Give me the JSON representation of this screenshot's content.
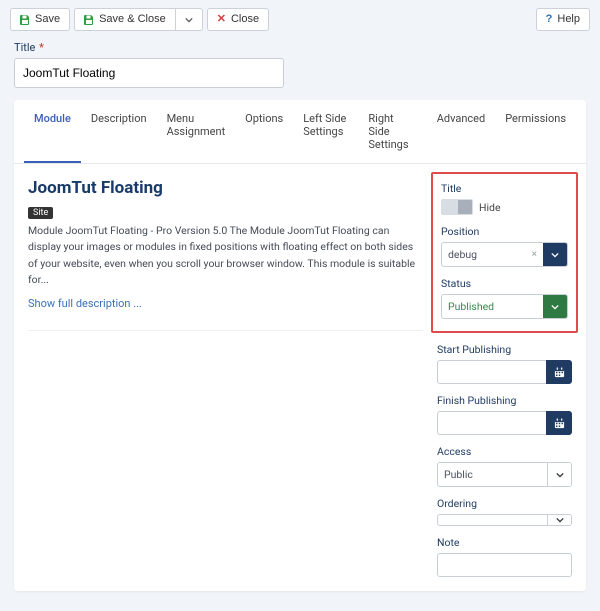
{
  "toolbar": {
    "save": "Save",
    "save_close": "Save & Close",
    "close": "Close",
    "help": "Help"
  },
  "title_field": {
    "label": "Title",
    "value": "JoomTut Floating"
  },
  "tabs": [
    {
      "id": "module",
      "label": "Module",
      "active": true
    },
    {
      "id": "description",
      "label": "Description"
    },
    {
      "id": "menu",
      "label": "Menu Assignment"
    },
    {
      "id": "options",
      "label": "Options"
    },
    {
      "id": "left",
      "label": "Left Side Settings"
    },
    {
      "id": "right",
      "label": "Right Side Settings"
    },
    {
      "id": "advanced",
      "label": "Advanced"
    },
    {
      "id": "permissions",
      "label": "Permissions"
    }
  ],
  "module": {
    "heading": "JoomTut Floating",
    "badge": "Site",
    "description": "Module JoomTut Floating - Pro Version 5.0 The Module JoomTut Floating can display your images or modules in fixed positions with floating effect on both sides of your website, even when you scroll your browser window. This module is suitable for...",
    "show_full": "Show full description ..."
  },
  "sidebar": {
    "title": {
      "label": "Title",
      "value": "Hide"
    },
    "position": {
      "label": "Position",
      "value": "debug"
    },
    "status": {
      "label": "Status",
      "value": "Published"
    },
    "start_publishing": {
      "label": "Start Publishing",
      "value": ""
    },
    "finish_publishing": {
      "label": "Finish Publishing",
      "value": ""
    },
    "access": {
      "label": "Access",
      "value": "Public"
    },
    "ordering": {
      "label": "Ordering",
      "value": ""
    },
    "note": {
      "label": "Note",
      "value": ""
    }
  }
}
